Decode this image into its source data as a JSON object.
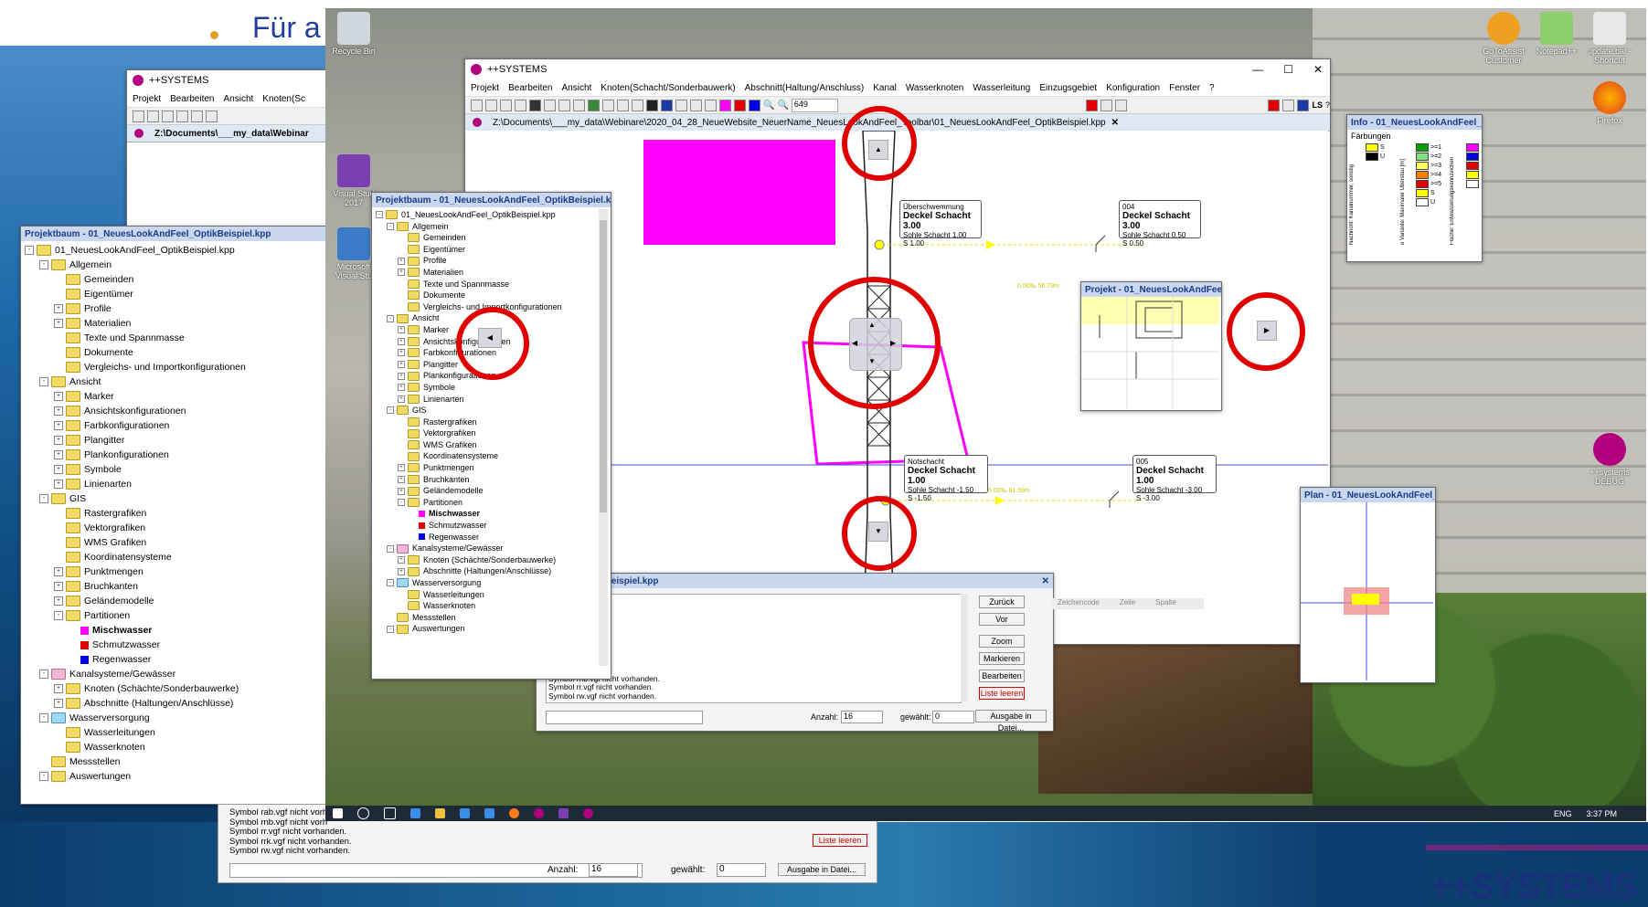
{
  "slide": {
    "bullet_text": "Für a",
    "brand": "++SYSTEMS"
  },
  "back_window": {
    "title": "++SYSTEMS",
    "menu": [
      "Projekt",
      "Bearbeiten",
      "Ansicht",
      "Knoten(Sc"
    ],
    "doc_tab": "Z:\\Documents\\___my_data\\Webinar",
    "tree_title": "Projektbaum - 01_NeuesLookAndFeel_OptikBeispiel.kpp",
    "log_lines": [
      "Symbol rab.vgf nicht vorh",
      "Symbol rnb.vgf nicht vorh",
      "Symbol rr.vgf nicht vorhanden.",
      "Symbol rrk.vgf nicht vorhanden.",
      "Symbol rw.vgf nicht vorhanden."
    ],
    "log_button": "Liste leeren",
    "anzahl_label": "Anzahl:",
    "anzahl_value": "16",
    "gewaehlt_label": "gewählt:",
    "gewaehlt_value": "0",
    "ausgabe_button": "Ausgabe in Datei..."
  },
  "tree": [
    {
      "label": "01_NeuesLookAndFeel_OptikBeispiel.kpp",
      "level": 0,
      "type": "folder",
      "exp": "-"
    },
    {
      "label": "Allgemein",
      "level": 1,
      "type": "folder",
      "exp": "-"
    },
    {
      "label": "Gemeinden",
      "level": 2,
      "type": "folder"
    },
    {
      "label": "Eigentümer",
      "level": 2,
      "type": "folder"
    },
    {
      "label": "Profile",
      "level": 2,
      "type": "folder",
      "exp": "+"
    },
    {
      "label": "Materialien",
      "level": 2,
      "type": "folder",
      "exp": "+"
    },
    {
      "label": "Texte und Spannmasse",
      "level": 2,
      "type": "folder"
    },
    {
      "label": "Dokumente",
      "level": 2,
      "type": "folder"
    },
    {
      "label": "Vergleichs- und Importkonfigurationen",
      "level": 2,
      "type": "folder"
    },
    {
      "label": "Ansicht",
      "level": 1,
      "type": "folder",
      "exp": "-"
    },
    {
      "label": "Marker",
      "level": 2,
      "type": "folder",
      "exp": "+"
    },
    {
      "label": "Ansichtskonfigurationen",
      "level": 2,
      "type": "folder",
      "exp": "+"
    },
    {
      "label": "Farbkonfigurationen",
      "level": 2,
      "type": "folder",
      "exp": "+"
    },
    {
      "label": "Plangitter",
      "level": 2,
      "type": "folder",
      "exp": "+"
    },
    {
      "label": "Plankonfigurationen",
      "level": 2,
      "type": "folder",
      "exp": "+"
    },
    {
      "label": "Symbole",
      "level": 2,
      "type": "folder",
      "exp": "+"
    },
    {
      "label": "Linienarten",
      "level": 2,
      "type": "folder",
      "exp": "+"
    },
    {
      "label": "GIS",
      "level": 1,
      "type": "folder",
      "exp": "-"
    },
    {
      "label": "Rastergrafiken",
      "level": 2,
      "type": "folder"
    },
    {
      "label": "Vektorgrafiken",
      "level": 2,
      "type": "folder"
    },
    {
      "label": "WMS Grafiken",
      "level": 2,
      "type": "folder"
    },
    {
      "label": "Koordinatensysteme",
      "level": 2,
      "type": "folder"
    },
    {
      "label": "Punktmengen",
      "level": 2,
      "type": "folder",
      "exp": "+"
    },
    {
      "label": "Bruchkanten",
      "level": 2,
      "type": "folder",
      "exp": "+"
    },
    {
      "label": "Geländemodelle",
      "level": 2,
      "type": "folder",
      "exp": "+"
    },
    {
      "label": "Partitionen",
      "level": 2,
      "type": "folder",
      "exp": "-"
    },
    {
      "label": "Mischwasser",
      "level": 3,
      "type": "color",
      "color": "#ff00ff",
      "bold": true
    },
    {
      "label": "Schmutzwasser",
      "level": 3,
      "type": "color",
      "color": "#e00000"
    },
    {
      "label": "Regenwasser",
      "level": 3,
      "type": "color",
      "color": "#0000e0"
    },
    {
      "label": "Kanalsysteme/Gewässer",
      "level": 1,
      "type": "folder-pink",
      "exp": "-"
    },
    {
      "label": "Knoten (Schächte/Sonderbauwerke)",
      "level": 2,
      "type": "folder",
      "exp": "+"
    },
    {
      "label": "Abschnitte (Haltungen/Anschlüsse)",
      "level": 2,
      "type": "folder",
      "exp": "+"
    },
    {
      "label": "Wasserversorgung",
      "level": 1,
      "type": "folder-cyan",
      "exp": "-"
    },
    {
      "label": "Wasserleitungen",
      "level": 2,
      "type": "folder"
    },
    {
      "label": "Wasserknoten",
      "level": 2,
      "type": "folder"
    },
    {
      "label": "Messstellen",
      "level": 1,
      "type": "folder"
    },
    {
      "label": "Auswertungen",
      "level": 1,
      "type": "folder",
      "exp": "-"
    }
  ],
  "desktop": {
    "icons": {
      "recycle": "Recycle Bin",
      "vs": "Visual Stud 2017",
      "vs_code": "Microsoft Visual Stu",
      "gotoassist": "GoToAssist Customer",
      "notepad": "Notepad++",
      "update": "update.bat - Shortcut",
      "firefox": "Firefox",
      "systems": "++systems DEBUG"
    },
    "clock": "3:37 PM",
    "lang": "ENG"
  },
  "main_window": {
    "title": "++SYSTEMS",
    "menu": [
      "Projekt",
      "Bearbeiten",
      "Ansicht",
      "Knoten(Schacht/Sonderbauwerk)",
      "Abschnitt(Haltung/Anschluss)",
      "Kanal",
      "Wasserknoten",
      "Wasserleitung",
      "Einzugsgebiet",
      "Konfiguration",
      "Fenster",
      "?"
    ],
    "zoom_value": "649",
    "ls_label": "LS",
    "doc_tab": "Z:\\Documents\\___my_data\\Webinare\\2020_04_28_NeueWebsite_NeuerName_NeuesLookAndFeel_Toolbar\\01_NeuesLookAndFeel_OptikBeispiel.kpp"
  },
  "tree_panel_title": "Projektbaum - 01_NeuesLookAndFeel_OptikBeispiel.kpp",
  "canvas": {
    "nodes": [
      {
        "key": "n1",
        "header": "Überschwemmung",
        "title": "Deckel Schacht 3.00",
        "sub": "Sohle Schacht 1.00",
        "val": "S 1.00"
      },
      {
        "key": "n2",
        "header": "004",
        "title": "Deckel Schacht 3.00",
        "sub": "Sohle Schacht 0.50",
        "val": "S 0.50"
      },
      {
        "key": "n3",
        "header": "Notschacht",
        "title": "Deckel Schacht 1.00",
        "sub": "Sohle Schacht -1.50",
        "val": "S -1.50"
      },
      {
        "key": "n4",
        "header": "005",
        "title": "Deckel Schacht 1.00",
        "sub": "Sohle Schacht -3.00",
        "val": "S -3.00"
      }
    ],
    "pipe_label_1": "0.50‰ 56.79m",
    "pipe_label_2": "25.00‰ 81.59m"
  },
  "info_panel": {
    "title": "Info - 01_NeuesLookAndFeel_Op...",
    "heading": "Färbungen",
    "legend_left": [
      {
        "label": "S",
        "color": "#ffff00"
      },
      {
        "label": "U",
        "color": "#000000"
      }
    ],
    "legend_mid": [
      {
        "label": ">=1",
        "color": "#00a000"
      },
      {
        "label": ">=2",
        "color": "#80e080"
      },
      {
        "label": ">=3",
        "color": "#ffff60"
      },
      {
        "label": ">=4",
        "color": "#ff8000"
      },
      {
        "label": ">=5",
        "color": "#e00000"
      },
      {
        "label": "S",
        "color": "#ffff00"
      },
      {
        "label": "U",
        "color": "#ffffff"
      }
    ],
    "legend_right": [
      "#ff00ff",
      "#0000e0",
      "#e00000",
      "#ffff00",
      "#ffffff"
    ],
    "vertical_1": "Nachricht: Kanalnummer, sonstig",
    "vertical_2": "e Variante: Maximaler Überstau [m]",
    "vertical_3": "Fläche: Entwässerungskennzeichen"
  },
  "projekt_panel": {
    "title": "Projekt - 01_NeuesLookAndFeel_..."
  },
  "plan_panel": {
    "title": "Plan - 01_NeuesLookAndFeel_O..."
  },
  "log_window": {
    "title": "AndFeel_OptikBeispiel.kpp",
    "lines": [
      "nden.",
      "nden.",
      "nden.",
      "nden.",
      "nden.",
      "nden.",
      "nden.",
      "nden.",
      "nden.",
      "Symbol rnb.vgf nicht vorhanden.",
      "Symbol rr.vgf nicht vorhanden.",
      "Symbol rw.vgf nicht vorhanden."
    ],
    "buttons": [
      "Zurück",
      "Vor",
      "Zoom",
      "Markieren",
      "Bearbeiten"
    ],
    "clear_button": "Liste leeren",
    "col_headers": [
      "Zeichencode",
      "Zeile",
      "Spalte"
    ],
    "anzahl_label": "Anzahl:",
    "anzahl_value": "16",
    "gewaehlt_label": "gewählt:",
    "gewaehlt_value": "0",
    "ausgabe_button": "Ausgabe in Datei..."
  }
}
